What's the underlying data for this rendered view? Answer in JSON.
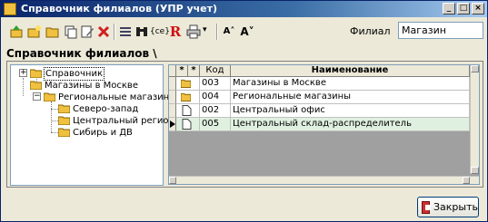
{
  "window": {
    "title": "Справочник филиалов (УПР учет)",
    "controls": [
      "_",
      "□",
      "×"
    ]
  },
  "toolbar": {
    "buttons": [
      {
        "icon": "up-arrow-folder-icon"
      },
      {
        "icon": "new-folder-icon"
      },
      {
        "icon": "folder-icon"
      },
      {
        "icon": "copy-icon"
      },
      {
        "icon": "edit-icon"
      },
      {
        "icon": "delete-icon"
      },
      {
        "icon": "list-icon"
      },
      {
        "icon": "search-binoculars-icon"
      },
      {
        "icon": "code-icon"
      },
      {
        "icon": "report-r-icon"
      },
      {
        "icon": "print-icon"
      },
      {
        "icon": "increase-font-icon"
      },
      {
        "icon": "decrease-font-icon"
      }
    ],
    "code_glyph": "{ce}",
    "r_glyph": "R",
    "font_up_glyph": "A˄",
    "font_down_glyph": "A˅",
    "print_dropdown_glyph": "▾"
  },
  "filter": {
    "label": "Филиал",
    "value": "Магазин"
  },
  "section": {
    "title": "Справочник филиалов \\"
  },
  "tree": {
    "nodes": [
      {
        "label": "Справочник",
        "expander": "+"
      },
      {
        "label": "Магазины в Москве"
      },
      {
        "label": "Региональные магазины",
        "expander": "−"
      },
      {
        "label": "Северо-запад"
      },
      {
        "label": "Центральный регион"
      },
      {
        "label": "Сибирь и ДВ"
      }
    ]
  },
  "grid": {
    "headers": {
      "mark1": "*",
      "mark2": "*",
      "code": "Код",
      "name": "Наименование"
    },
    "rows": [
      {
        "type": "folder",
        "code": "003",
        "name": "Магазины в Москве"
      },
      {
        "type": "folder",
        "code": "004",
        "name": "Региональные магазины"
      },
      {
        "type": "doc",
        "code": "002",
        "name": "Центральный офис"
      },
      {
        "type": "doc",
        "code": "005",
        "name": "Центральный склад-распределитель",
        "current": true
      }
    ]
  },
  "footer": {
    "close_label": "Закрыть"
  },
  "colors": {
    "title_bar": "#0a246a",
    "folder": "#f0c040",
    "selected_row": "#e0f0e0"
  }
}
